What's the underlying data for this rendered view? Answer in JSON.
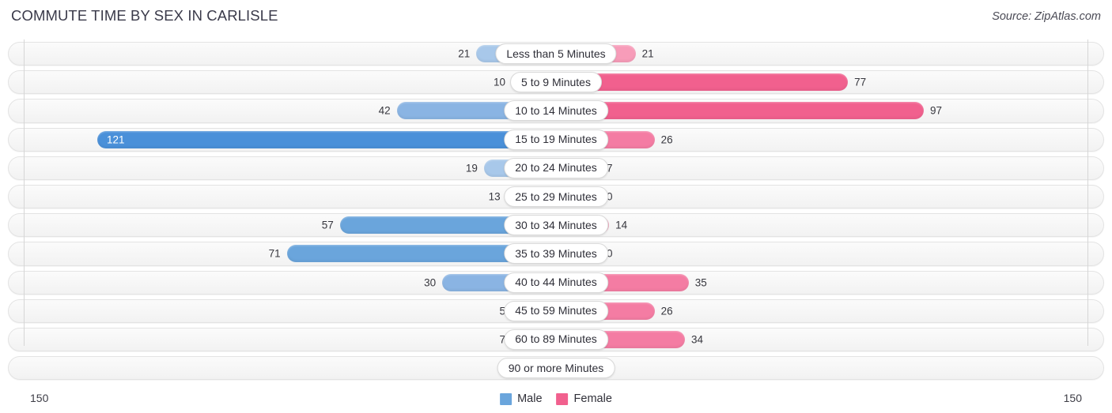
{
  "header": {
    "title": "COMMUTE TIME BY SEX IN CARLISLE",
    "source": "Source: ZipAtlas.com"
  },
  "axis": {
    "left_label": "150",
    "right_label": "150",
    "max": 150
  },
  "legend": {
    "male_label": "Male",
    "female_label": "Female"
  },
  "colors": {
    "male": "#6aa5dc",
    "male_light": "#a8c8ea",
    "male_mid": "#8ab4e3",
    "male_strong": "#4a90d9",
    "female": "#f1608e",
    "female_light": "#f79cb9",
    "female_mid": "#f47ca3",
    "female_strong": "#ef5287",
    "track": "#f6f6f6",
    "gridline": "#d6d6d6",
    "title": "#3a3a4a"
  },
  "chart_data": {
    "type": "bar",
    "title": "COMMUTE TIME BY SEX IN CARLISLE",
    "subtitle": "",
    "orientation": "horizontal-diverging",
    "xlabel": "",
    "ylabel": "",
    "xlim": [
      150,
      150
    ],
    "grid": true,
    "legend_position": "bottom-center",
    "categories": [
      "Less than 5 Minutes",
      "5 to 9 Minutes",
      "10 to 14 Minutes",
      "15 to 19 Minutes",
      "20 to 24 Minutes",
      "25 to 29 Minutes",
      "30 to 34 Minutes",
      "35 to 39 Minutes",
      "40 to 44 Minutes",
      "45 to 59 Minutes",
      "60 to 89 Minutes",
      "90 or more Minutes"
    ],
    "series": [
      {
        "name": "Male",
        "values": [
          21,
          10,
          42,
          121,
          19,
          13,
          57,
          71,
          30,
          5,
          7,
          0
        ]
      },
      {
        "name": "Female",
        "values": [
          21,
          77,
          97,
          26,
          7,
          0,
          14,
          0,
          35,
          26,
          34,
          0
        ]
      }
    ]
  },
  "rows": [
    {
      "label": "Less than 5 Minutes",
      "male": "21",
      "female": "21"
    },
    {
      "label": "5 to 9 Minutes",
      "male": "10",
      "female": "77"
    },
    {
      "label": "10 to 14 Minutes",
      "male": "42",
      "female": "97"
    },
    {
      "label": "15 to 19 Minutes",
      "male": "121",
      "female": "26"
    },
    {
      "label": "20 to 24 Minutes",
      "male": "19",
      "female": "7"
    },
    {
      "label": "25 to 29 Minutes",
      "male": "13",
      "female": "0"
    },
    {
      "label": "30 to 34 Minutes",
      "male": "57",
      "female": "14"
    },
    {
      "label": "35 to 39 Minutes",
      "male": "71",
      "female": "0"
    },
    {
      "label": "40 to 44 Minutes",
      "male": "30",
      "female": "35"
    },
    {
      "label": "45 to 59 Minutes",
      "male": "5",
      "female": "26"
    },
    {
      "label": "60 to 89 Minutes",
      "male": "7",
      "female": "34"
    },
    {
      "label": "90 or more Minutes",
      "male": "0",
      "female": "0"
    }
  ]
}
